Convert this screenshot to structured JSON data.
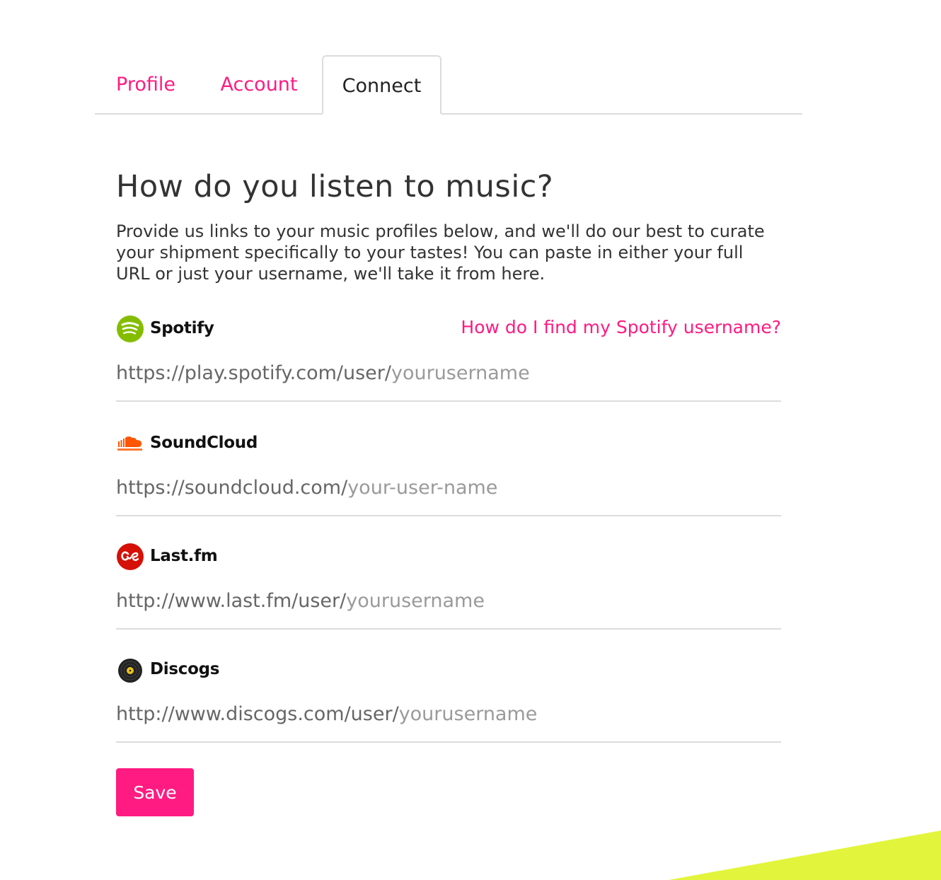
{
  "tabs": [
    {
      "label": "Profile",
      "active": false
    },
    {
      "label": "Account",
      "active": false
    },
    {
      "label": "Connect",
      "active": true
    }
  ],
  "main": {
    "heading": "How do you listen to music?",
    "intro": "Provide us links to your music profiles below, and we'll do our best to curate your shipment specifically to your tastes! You can paste in either your full URL or just your username, we'll take it from here."
  },
  "services": {
    "spotify": {
      "name": "Spotify",
      "icon": "spotify-icon",
      "help_link": "How do I find my Spotify username?",
      "prefix": "https://play.spotify.com/user/",
      "placeholder": "yourusername"
    },
    "soundcloud": {
      "name": "SoundCloud",
      "icon": "soundcloud-icon",
      "prefix": "https://soundcloud.com/",
      "placeholder": "your-user-name"
    },
    "lastfm": {
      "name": "Last.fm",
      "icon": "lastfm-icon",
      "prefix": "http://www.last.fm/user/",
      "placeholder": "yourusername"
    },
    "discogs": {
      "name": "Discogs",
      "icon": "discogs-icon",
      "prefix": "http://www.discogs.com/user/",
      "placeholder": "yourusername"
    }
  },
  "save_label": "Save",
  "colors": {
    "accent": "#ff1b82",
    "corner_accent": "#e2f53c",
    "spotify": "#84bd00",
    "soundcloud": "#ff5500",
    "lastfm": "#d51007"
  }
}
